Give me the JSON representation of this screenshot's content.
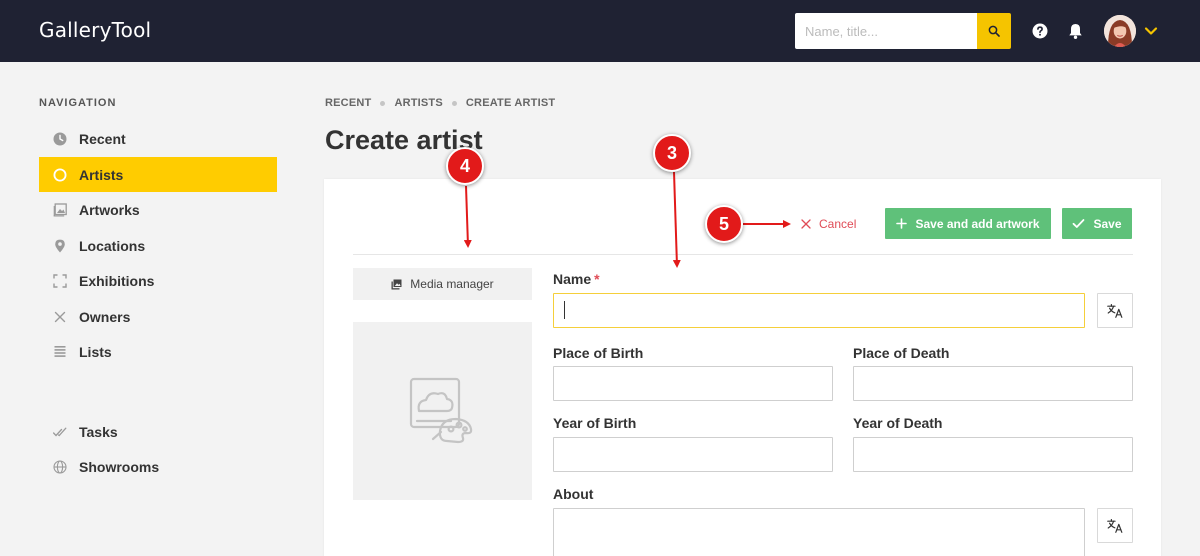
{
  "app": {
    "title": "GalleryTool"
  },
  "header": {
    "search_placeholder": "Name, title..."
  },
  "sidebar": {
    "heading": "NAVIGATION",
    "items": [
      {
        "label": "Recent",
        "icon": "clock-icon"
      },
      {
        "label": "Artists",
        "icon": "circle-icon",
        "active": true
      },
      {
        "label": "Artworks",
        "icon": "image-icon"
      },
      {
        "label": "Locations",
        "icon": "pin-icon"
      },
      {
        "label": "Exhibitions",
        "icon": "frame-icon"
      },
      {
        "label": "Owners",
        "icon": "close-x-icon"
      },
      {
        "label": "Lists",
        "icon": "list-icon"
      },
      {
        "label": "Tasks",
        "icon": "check-double-icon"
      },
      {
        "label": "Showrooms",
        "icon": "globe-icon"
      }
    ]
  },
  "breadcrumb": [
    "RECENT",
    "ARTISTS",
    "CREATE ARTIST"
  ],
  "page": {
    "title": "Create artist"
  },
  "actions": {
    "cancel": "Cancel",
    "save_and_add": "Save and add artwork",
    "save": "Save"
  },
  "media": {
    "button_label": "Media manager"
  },
  "form": {
    "name": {
      "label": "Name",
      "required_mark": "*",
      "value": ""
    },
    "place_of_birth": {
      "label": "Place of Birth",
      "value": ""
    },
    "place_of_death": {
      "label": "Place of Death",
      "value": ""
    },
    "year_of_birth": {
      "label": "Year of Birth",
      "value": ""
    },
    "year_of_death": {
      "label": "Year of Death",
      "value": ""
    },
    "about": {
      "label": "About",
      "value": ""
    }
  },
  "annotations": [
    "4",
    "3",
    "5"
  ],
  "colors": {
    "topbar": "#1f2233",
    "accent": "#ffcc00",
    "save_green": "#5fc17a",
    "cancel_red": "#e04c57",
    "marker_red": "#e21a1a"
  }
}
